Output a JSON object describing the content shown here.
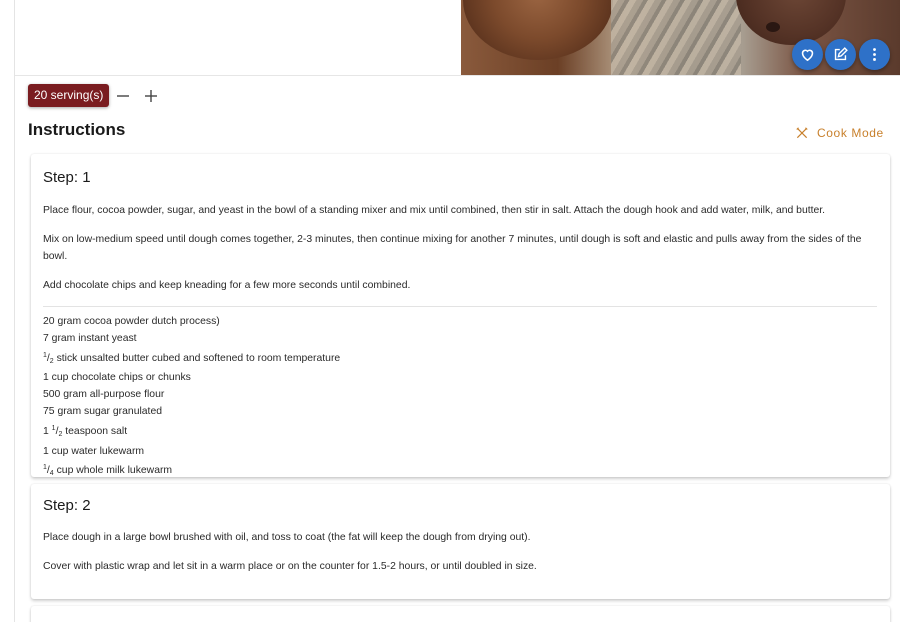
{
  "actions": {
    "favorite_icon": "heart-outline-icon",
    "edit_icon": "edit-icon",
    "more_icon": "more-vertical-icon",
    "accent_color": "#2e71c8"
  },
  "servings": {
    "label": "20 serving(s)",
    "chip_color": "#7a1c20",
    "decrease_icon": "minus-icon",
    "increase_icon": "plus-icon"
  },
  "instructions": {
    "title": "Instructions",
    "cook_mode_label": "Cook Mode",
    "cook_mode_icon": "utensils-crossed-icon",
    "cook_mode_color": "#c8802c"
  },
  "steps": [
    {
      "title": "Step: 1",
      "paragraphs": [
        "Place flour, cocoa powder, sugar, and yeast in the bowl of a standing mixer and mix until combined, then stir in salt. Attach the dough hook and add water, milk, and butter.",
        "Mix on low-medium speed until dough comes together, 2-3 minutes, then continue mixing for another 7 minutes, until dough is soft and elastic and pulls away from the sides of the bowl.",
        "Add chocolate chips and keep kneading for a few more seconds until combined."
      ],
      "ingredients": [
        {
          "qty": "20 gram",
          "name": "cocoa powder dutch process)"
        },
        {
          "qty": "7 gram",
          "name": "instant yeast"
        },
        {
          "whole": "",
          "num": "1",
          "den": "2",
          "name": "stick unsalted butter cubed and softened to room temperature"
        },
        {
          "qty": "1 cup",
          "name": "chocolate chips or chunks"
        },
        {
          "qty": "500 gram",
          "name": "all-purpose flour"
        },
        {
          "qty": "75 gram",
          "name": "sugar granulated"
        },
        {
          "whole": "1",
          "num": "1",
          "den": "2",
          "name": "teaspoon salt"
        },
        {
          "qty": "1 cup",
          "name": "water lukewarm"
        },
        {
          "whole": "",
          "num": "1",
          "den": "4",
          "name": "cup whole milk lukewarm"
        }
      ]
    },
    {
      "title": "Step: 2",
      "paragraphs": [
        "Place dough in a large bowl brushed with oil, and toss to coat (the fat will keep the dough from drying out).",
        "Cover with plastic wrap and let sit in a warm place or on the counter for 1.5-2 hours, or until doubled in size."
      ]
    }
  ]
}
